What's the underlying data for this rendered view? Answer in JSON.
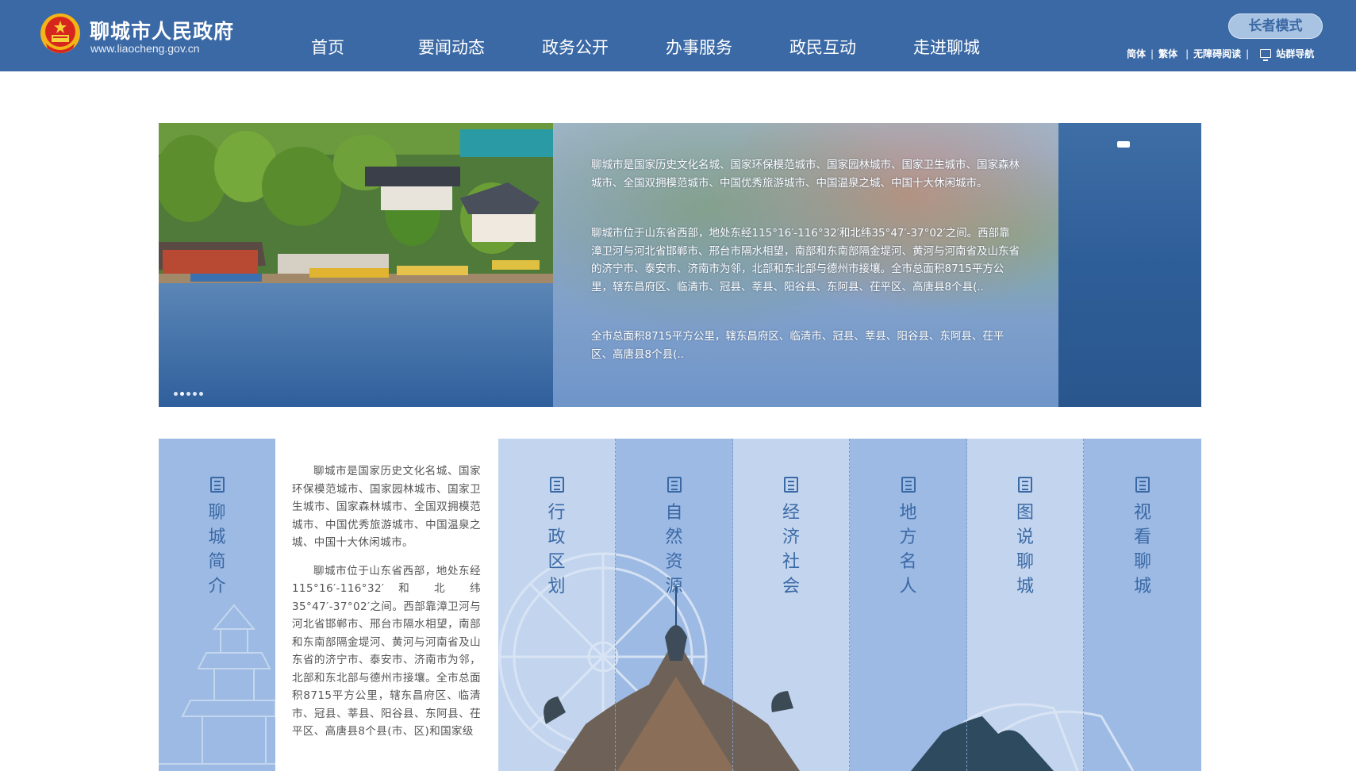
{
  "header": {
    "site_title": "聊城市人民政府",
    "site_url": "www.liaocheng.gov.cn",
    "nav": [
      "首页",
      "要闻动态",
      "政务公开",
      "办事服务",
      "政民互动",
      "走进聊城"
    ],
    "elder_mode": "长者模式",
    "util": {
      "simplified": "简体",
      "traditional": "繁体",
      "accessible": "无障碍阅读",
      "sitemap": "站群导航"
    }
  },
  "banner": {
    "p1": "聊城市是国家历史文化名城、国家环保模范城市、国家园林城市、国家卫生城市、国家森林城市、全国双拥模范城市、中国优秀旅游城市、中国温泉之城、中国十大休闲城市。",
    "p2": "聊城市位于山东省西部，地处东经115°16′-116°32′和北纬35°47′-37°02′之间。西部靠漳卫河与河北省邯郸市、邢台市隔水相望，南部和东南部隔金堤河、黄河与河南省及山东省的济宁市、泰安市、济南市为邻，北部和东北部与德州市接壤。全市总面积8715平方公里，辖东昌府区、临清市、冠县、莘县、阳谷县、东阿县、茌平区、高唐县8个县(..",
    "p3": "全市总面积8715平方公里，辖东昌府区、临清市、冠县、莘县、阳谷县、东阿县、茌平区、高唐县8个县(..",
    "slide_count": 5,
    "active_slide": 1
  },
  "intro": {
    "card_title": "聊城简介",
    "p1": "聊城市是国家历史文化名城、国家环保模范城市、国家园林城市、国家卫生城市、国家森林城市、全国双拥模范城市、中国优秀旅游城市、中国温泉之城、中国十大休闲城市。",
    "p2": "聊城市位于山东省西部，地处东经 115°16′-116°32′ 和 北 纬 35°47′-37°02′之间。西部靠漳卫河与河北省邯郸市、邢台市隔水相望，南部和东南部隔金堤河、黄河与河南省及山东省的济宁市、泰安市、济南市为邻，北部和东北部与德州市接壤。全市总面积8715平方公里，辖东昌府区、临清市、冠县、莘县、阳谷县、东阿县、茌平区、高唐县8个县(市、区)和国家级"
  },
  "columns": [
    {
      "title": "行政区划"
    },
    {
      "title": "自然资源"
    },
    {
      "title": "经济社会"
    },
    {
      "title": "地方名人"
    },
    {
      "title": "图说聊城"
    },
    {
      "title": "视看聊城"
    }
  ],
  "colors": {
    "header_bg": "#3b69a5",
    "accent": "#3b69a5",
    "card_light": "#c3d5ee",
    "card_dark": "#9cbae4"
  }
}
